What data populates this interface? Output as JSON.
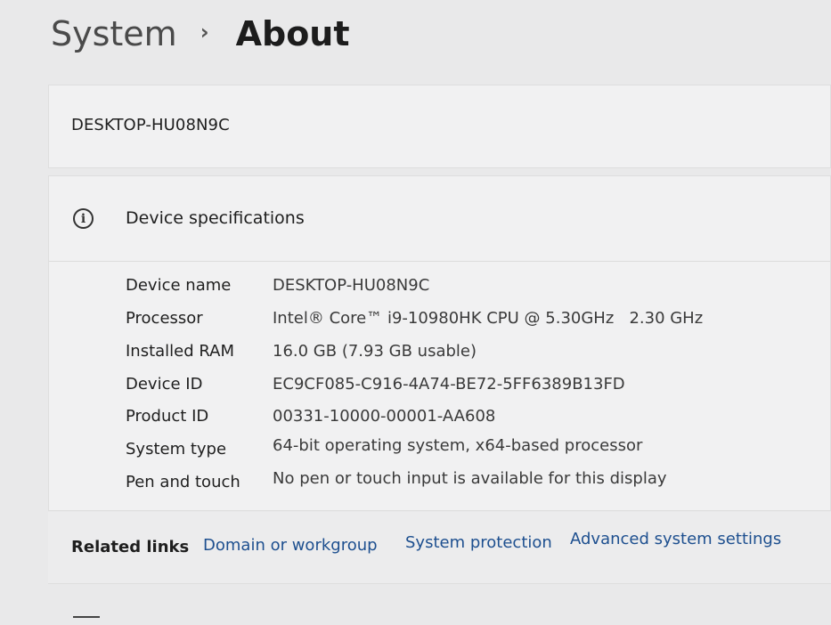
{
  "breadcrumb": {
    "parent": "System",
    "separator": "›",
    "current": "About"
  },
  "device_card": {
    "name": "DESKTOP-HU08N9C"
  },
  "specs": {
    "title": "Device specifications",
    "icon": "info-icon",
    "rows": [
      {
        "label": "Device name",
        "value": "DESKTOP-HU08N9C"
      },
      {
        "label": "Processor",
        "value": "Intel® Core™ i9-10980HK CPU @ 5.30GHz   2.30 GHz"
      },
      {
        "label": "Installed RAM",
        "value": "16.0 GB (7.93 GB usable)"
      },
      {
        "label": "Device ID",
        "value": "EC9CF085-C916-4A74-BE72-5FF6389B13FD"
      },
      {
        "label": "Product ID",
        "value": "00331-10000-00001-AA608"
      },
      {
        "label": "System type",
        "value": "64-bit operating system, x64-based processor"
      },
      {
        "label": "Pen and touch",
        "value": "No pen or touch input is available for this display"
      }
    ]
  },
  "related_links": {
    "label": "Related links",
    "links": [
      "Domain or workgroup",
      "System protection",
      "Advanced system settings"
    ]
  },
  "colors": {
    "link": "#1d4f8f",
    "background": "#e9e9ea",
    "card": "#f1f1f2"
  }
}
